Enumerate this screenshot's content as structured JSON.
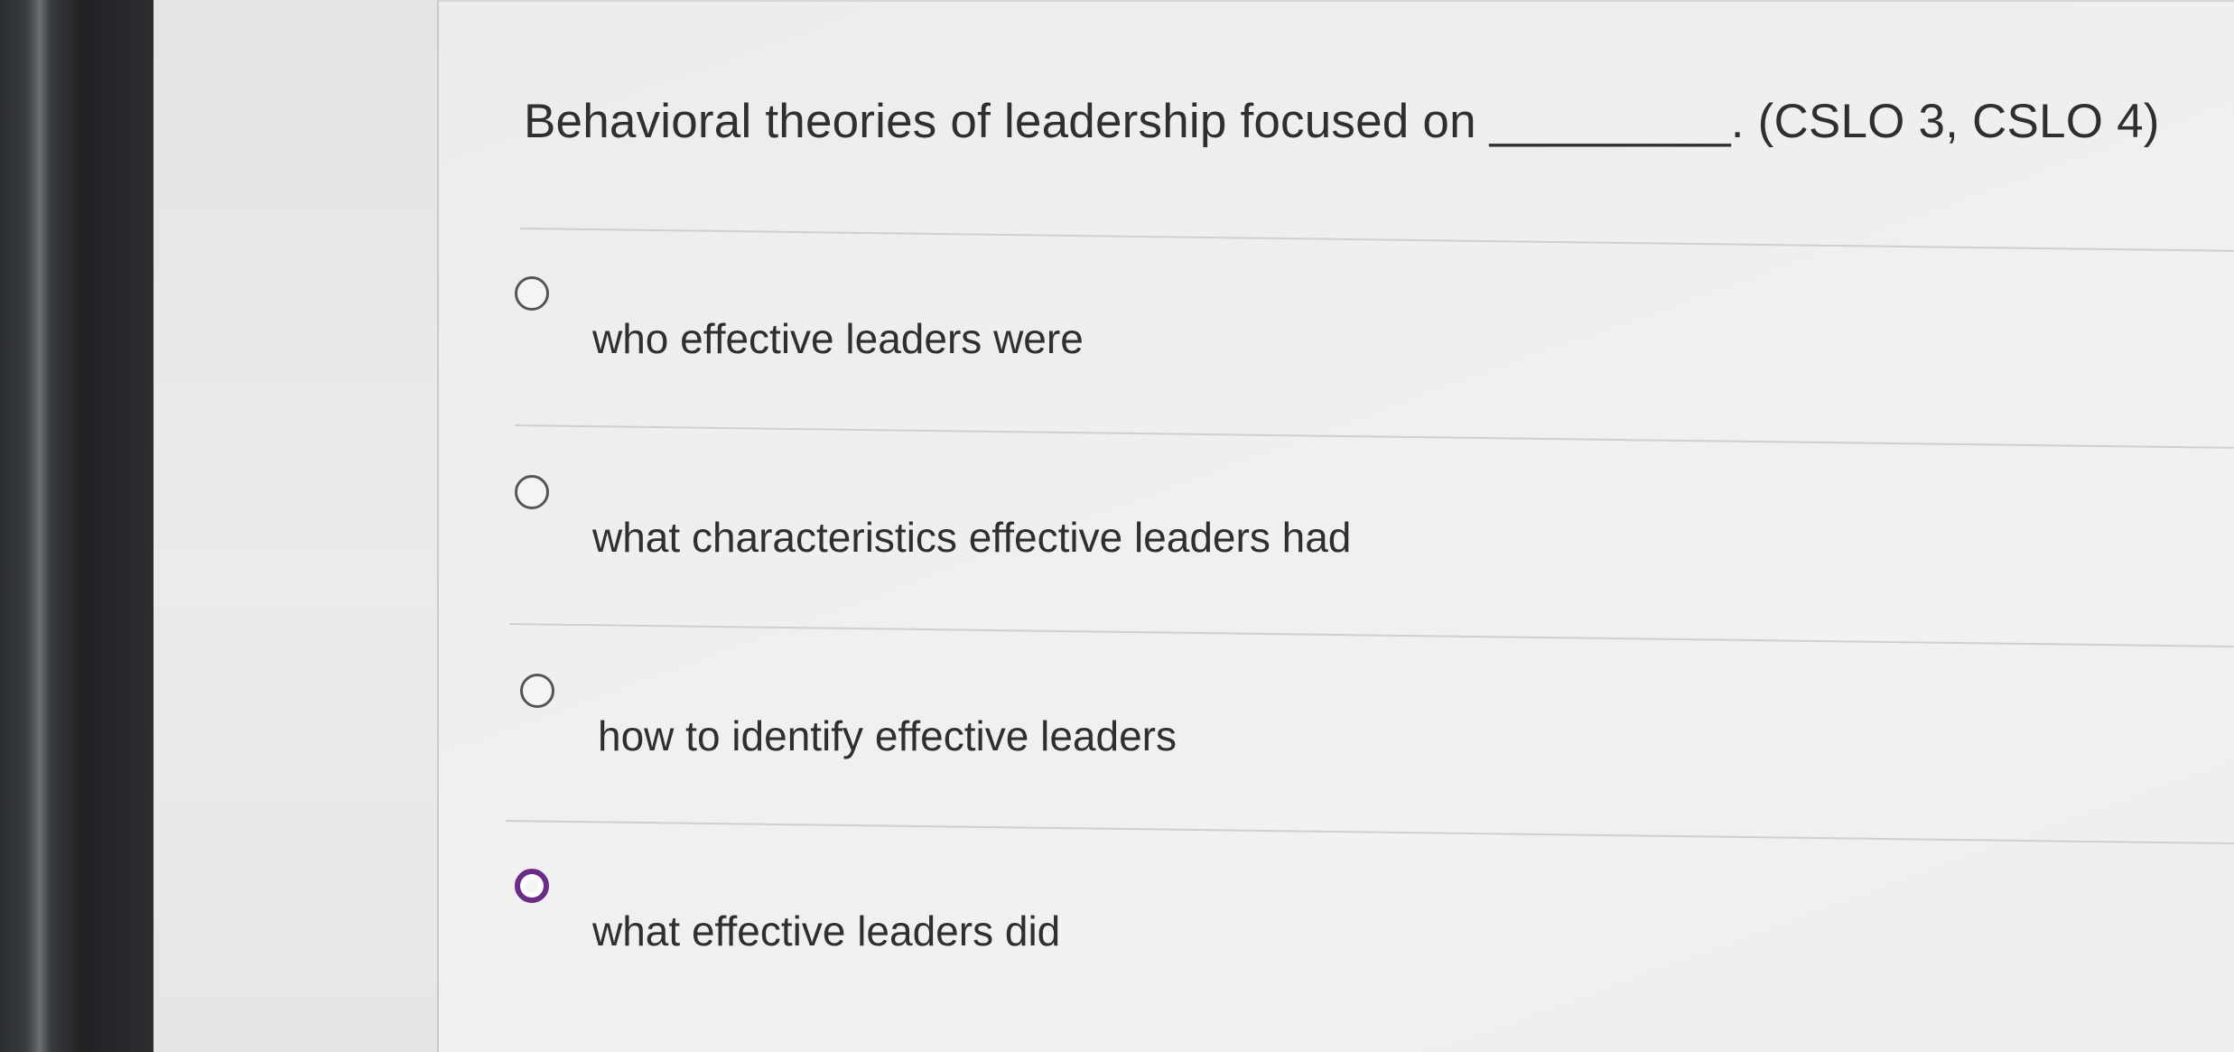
{
  "question": {
    "text": "Behavioral theories of leadership focused on _________. (CSLO 3, CSLO 4)"
  },
  "options": [
    {
      "label": "who effective leaders were",
      "selected": false
    },
    {
      "label": "what characteristics effective leaders had",
      "selected": false
    },
    {
      "label": "how to identify effective leaders",
      "selected": false
    },
    {
      "label": "what effective leaders did",
      "selected": true
    }
  ],
  "colors": {
    "accent": "#6a2c86",
    "text": "#2f2f2f",
    "divider": "#cfcfcf"
  },
  "icons": {
    "radio_unselected": "radio-empty-icon",
    "radio_selected": "radio-filled-icon"
  }
}
